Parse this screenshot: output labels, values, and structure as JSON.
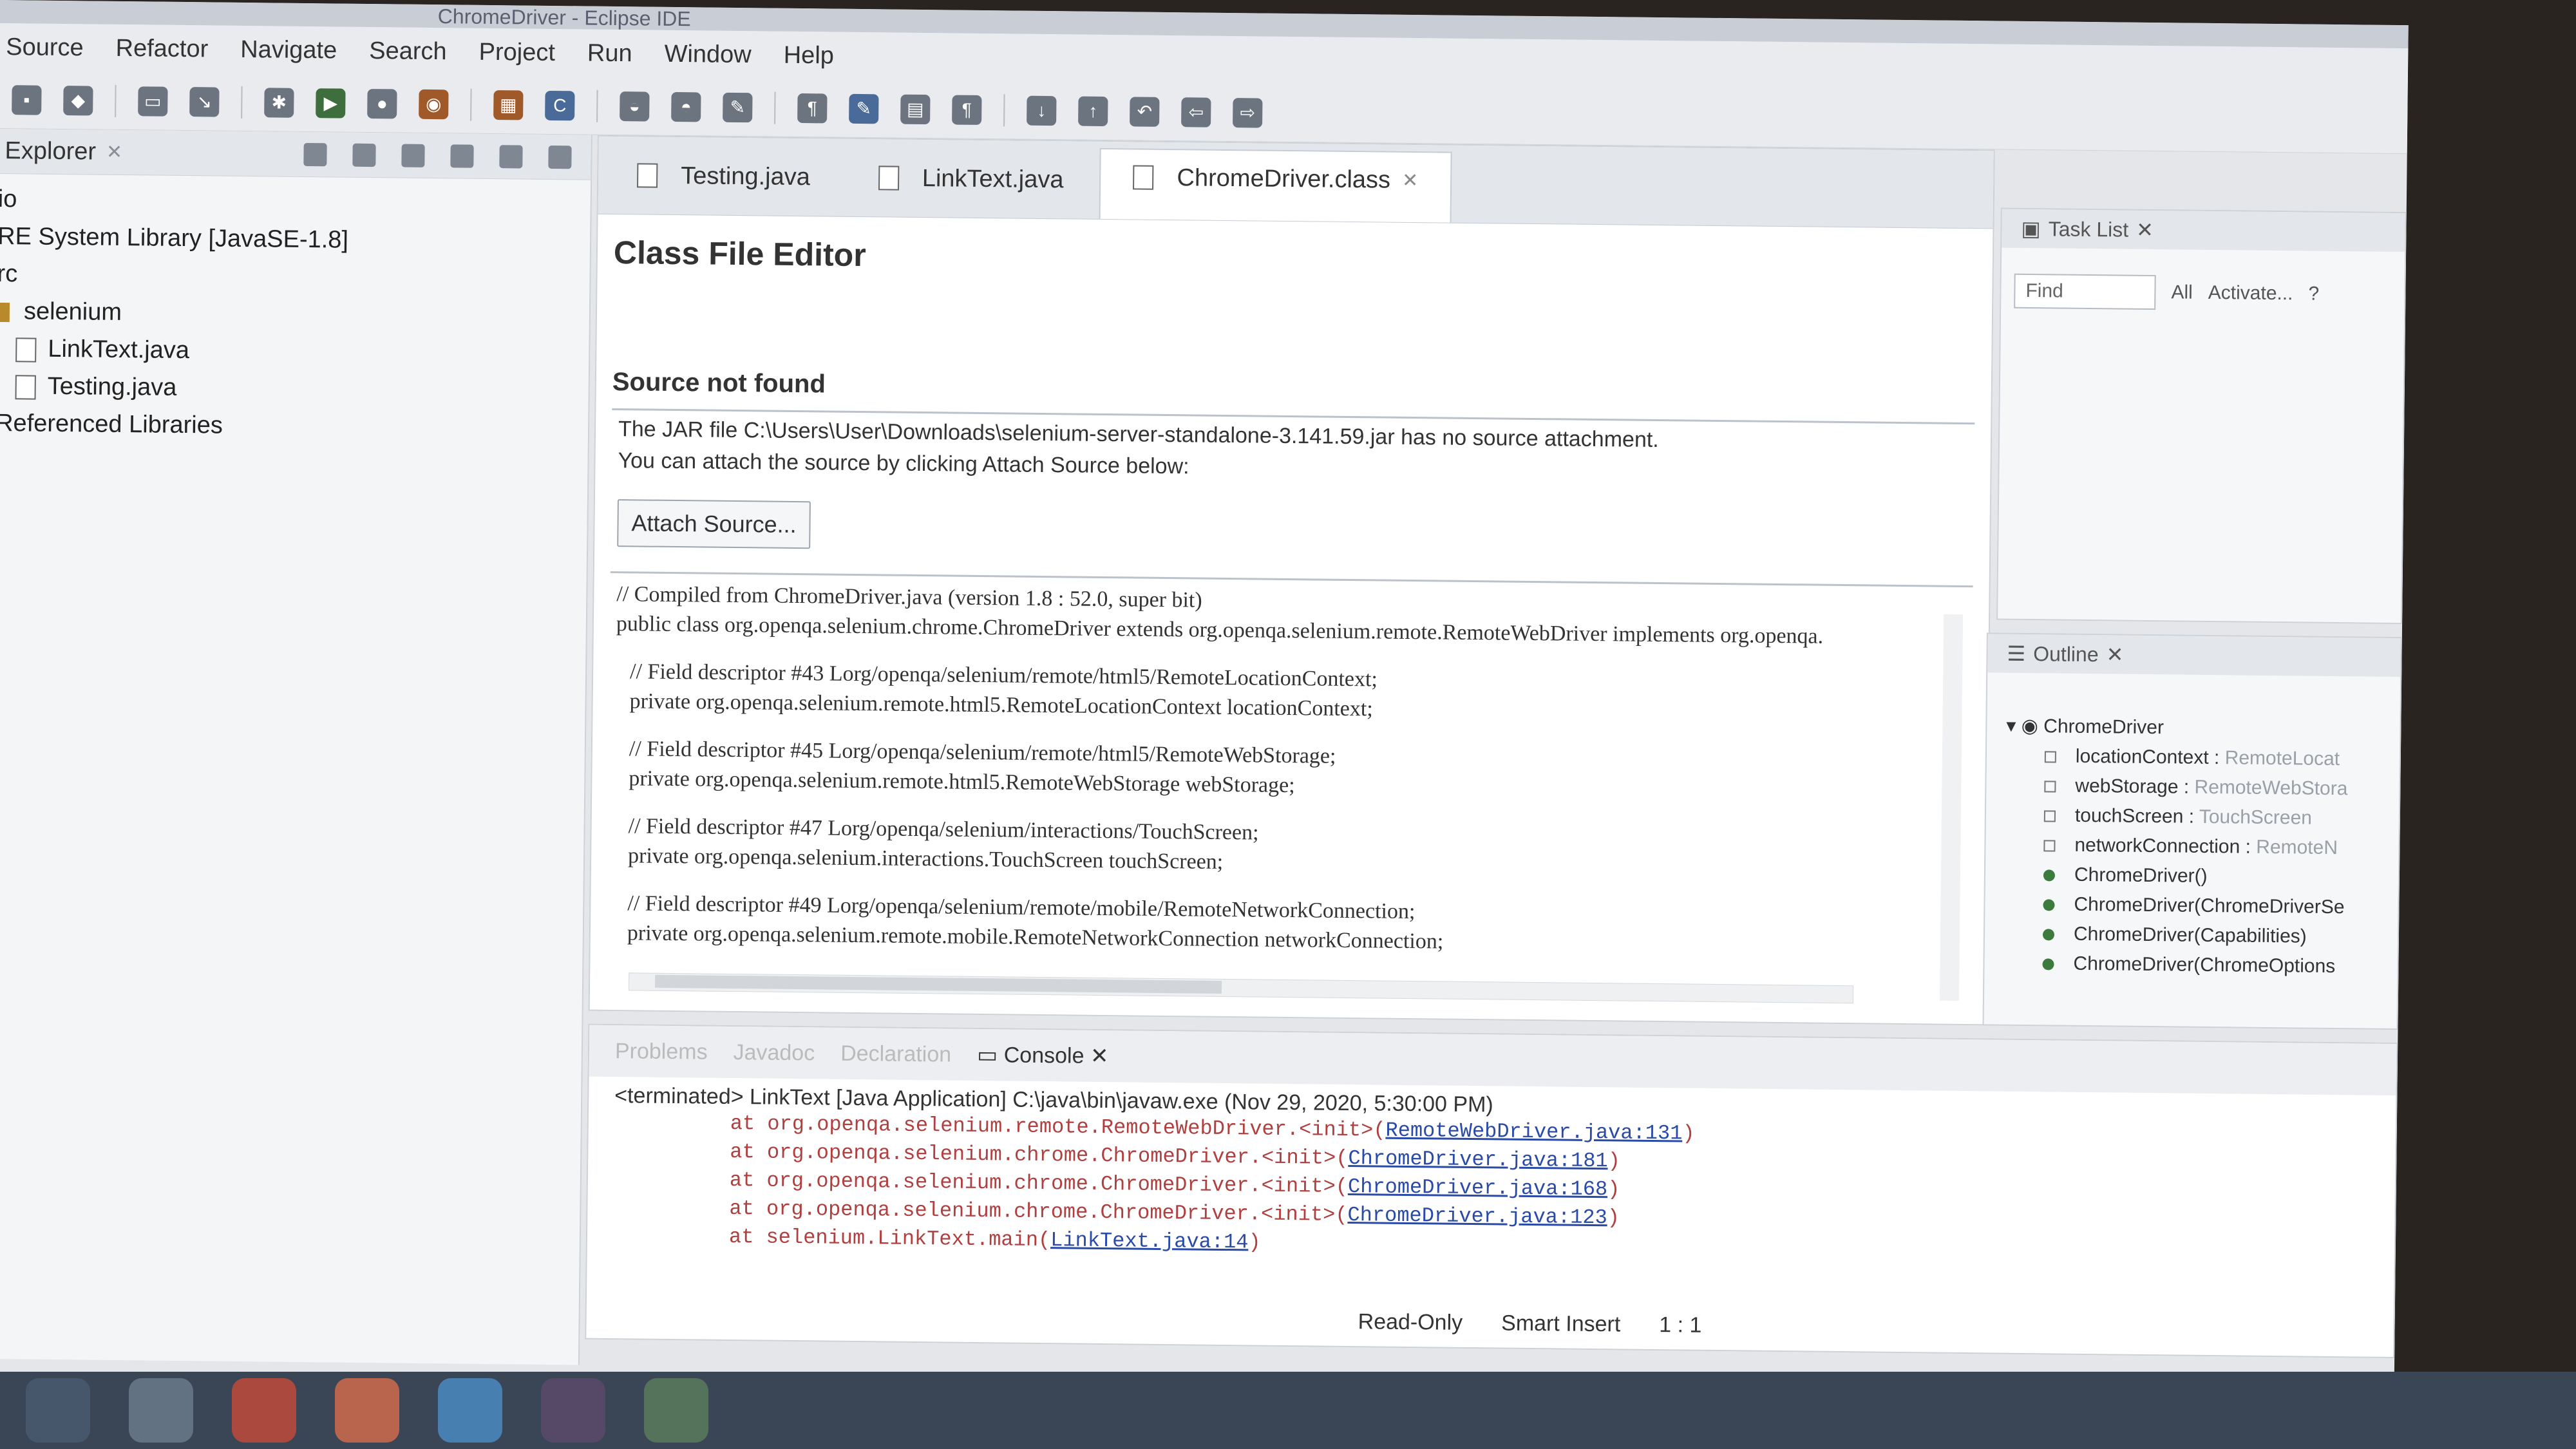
{
  "window": {
    "title": "ChromeDriver - Eclipse IDE"
  },
  "menu": [
    "Source",
    "Refactor",
    "Navigate",
    "Search",
    "Project",
    "Run",
    "Window",
    "Help"
  ],
  "explorer": {
    "title": "Explorer",
    "items": [
      {
        "label": "io",
        "type": "project"
      },
      {
        "label": "RE System Library [JavaSE-1.8]",
        "type": "library"
      },
      {
        "label": "rc",
        "type": "folder"
      },
      {
        "label": "selenium",
        "type": "package"
      },
      {
        "label": "LinkText.java",
        "type": "file",
        "selected": true
      },
      {
        "label": "Testing.java",
        "type": "file"
      },
      {
        "label": "Referenced Libraries",
        "type": "library"
      }
    ]
  },
  "editor": {
    "tabs": [
      {
        "label": "Testing.java",
        "active": false
      },
      {
        "label": "LinkText.java",
        "active": false
      },
      {
        "label": "ChromeDriver.class",
        "active": true
      }
    ],
    "heading": "Class File Editor",
    "subheading": "Source not found",
    "message1": "The JAR file C:\\Users\\User\\Downloads\\selenium-server-standalone-3.141.59.jar has no source attachment.",
    "message2": "You can attach the source by clicking Attach Source below:",
    "attach_button": "Attach Source...",
    "code": [
      "// Compiled from ChromeDriver.java (version 1.8 : 52.0, super bit)",
      "public class org.openqa.selenium.chrome.ChromeDriver extends org.openqa.selenium.remote.RemoteWebDriver implements org.openqa.",
      "// Field descriptor #43 Lorg/openqa/selenium/remote/html5/RemoteLocationContext;",
      "private org.openqa.selenium.remote.html5.RemoteLocationContext locationContext;",
      "// Field descriptor #45 Lorg/openqa/selenium/remote/html5/RemoteWebStorage;",
      "private org.openqa.selenium.remote.html5.RemoteWebStorage webStorage;",
      "// Field descriptor #47 Lorg/openqa/selenium/interactions/TouchScreen;",
      "private org.openqa.selenium.interactions.TouchScreen touchScreen;",
      "// Field descriptor #49 Lorg/openqa/selenium/remote/mobile/RemoteNetworkConnection;",
      "private org.openqa.selenium.remote.mobile.RemoteNetworkConnection networkConnection;"
    ]
  },
  "tasklist": {
    "title": "Task List",
    "find_placeholder": "Find",
    "all": "All",
    "activate": "Activate..."
  },
  "outline": {
    "title": "Outline",
    "root": "ChromeDriver",
    "items": [
      {
        "name": "locationContext",
        "type": "RemoteLocat",
        "kind": "field"
      },
      {
        "name": "webStorage",
        "type": "RemoteWebStora",
        "kind": "field"
      },
      {
        "name": "touchScreen",
        "type": "TouchScreen",
        "kind": "field"
      },
      {
        "name": "networkConnection",
        "type": "RemoteN",
        "kind": "field"
      },
      {
        "name": "ChromeDriver()",
        "type": "",
        "kind": "constructor"
      },
      {
        "name": "ChromeDriver(ChromeDriverSe",
        "type": "",
        "kind": "constructor"
      },
      {
        "name": "ChromeDriver(Capabilities)",
        "type": "",
        "kind": "constructor"
      },
      {
        "name": "ChromeDriver(ChromeOptions",
        "type": "",
        "kind": "constructor"
      }
    ]
  },
  "console": {
    "tabs": [
      "Problems",
      "Javadoc",
      "Declaration",
      "Console"
    ],
    "status": "<terminated> LinkText [Java Application] C:\\java\\bin\\javaw.exe (Nov 29, 2020, 5:30:00 PM)",
    "trace": [
      {
        "prefix": "at org.openqa.selenium.remote.RemoteWebDriver.<init>(",
        "link": "RemoteWebDriver.java:131",
        "suffix": ")"
      },
      {
        "prefix": "at org.openqa.selenium.chrome.ChromeDriver.<init>(",
        "link": "ChromeDriver.java:181",
        "suffix": ")"
      },
      {
        "prefix": "at org.openqa.selenium.chrome.ChromeDriver.<init>(",
        "link": "ChromeDriver.java:168",
        "suffix": ")"
      },
      {
        "prefix": "at org.openqa.selenium.chrome.ChromeDriver.<init>(",
        "link": "ChromeDriver.java:123",
        "suffix": ")"
      },
      {
        "prefix": "at selenium.LinkText.main(",
        "link": "LinkText.java:14",
        "suffix": ")"
      }
    ]
  },
  "status": {
    "mode": "Read-Only",
    "insert": "Smart Insert",
    "position": "1 : 1"
  }
}
